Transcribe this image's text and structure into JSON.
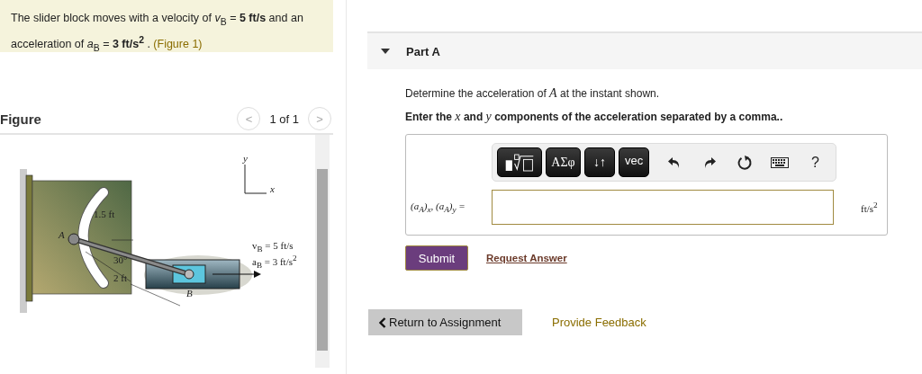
{
  "problem": {
    "text": "The slider block moves with a velocity of *v*$_{B}$ = **5 ft/s** and an acceleration of *a*$_{B}$ = **3 ft/s$^{2}$** .",
    "figure_link": "(Figure 1)"
  },
  "figure": {
    "title": "Figure",
    "pager": "1 of 1",
    "prev": "<",
    "next": ">",
    "labels": [
      {
        "kind": "axis",
        "text": "y"
      },
      {
        "kind": "axis",
        "text": "x"
      },
      {
        "kind": "dim",
        "text": "1.5 ft"
      },
      {
        "kind": "point",
        "text": "A"
      },
      {
        "kind": "dim",
        "text": "30°"
      },
      {
        "kind": "dim",
        "text": "2 ft"
      },
      {
        "kind": "point",
        "text": "B"
      },
      {
        "kind": "dim",
        "text": "v$_{B}$ = 5 ft/s"
      },
      {
        "kind": "dim",
        "text": "a$_{B}$ = 3 ft/s$^{2}$"
      }
    ]
  },
  "part": {
    "title": "Part A",
    "expanded": true,
    "question": "Determine the acceleration of *A* at the instant shown.",
    "instruction": "Enter the *x* and *y* components of the acceleration separated by a comma..",
    "toolbar": [
      {
        "kind": "template"
      },
      {
        "kind": "menu",
        "text": "ΑΣφ"
      },
      {
        "kind": "menu",
        "text": "↓↑"
      },
      {
        "kind": "menu",
        "text": "vec"
      },
      {
        "kind": "undo"
      },
      {
        "kind": "redo"
      },
      {
        "kind": "reset"
      },
      {
        "kind": "keyboard"
      },
      {
        "kind": "plain",
        "text": "?"
      }
    ],
    "answer_label": "(*a*$_{A}$)$_{x}$, (*a*$_{A}$)$_{y}$ =",
    "units": "ft/s$^{2}$",
    "submit": "Submit",
    "request": "Request Answer"
  },
  "footer": {
    "return": "Return to Assignment",
    "feedback": "Provide Feedback"
  }
}
